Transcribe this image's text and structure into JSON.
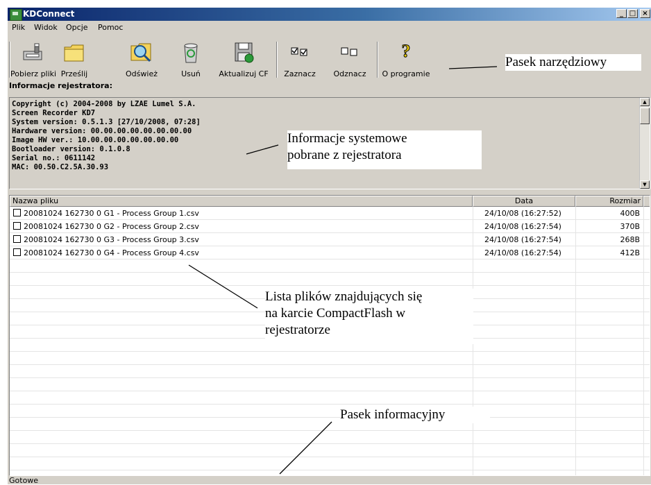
{
  "window": {
    "title": "KDConnect"
  },
  "menu": [
    "Plik",
    "Widok",
    "Opcje",
    "Pomoc"
  ],
  "toolbar": {
    "buttons": [
      {
        "label": "Pobierz pliki",
        "icon": "download-disk-icon"
      },
      {
        "label": "Prześlij",
        "icon": "folder-icon"
      },
      {
        "label": "Odśwież",
        "icon": "magnifier-icon"
      },
      {
        "label": "Usuń",
        "icon": "recycle-bin-icon"
      },
      {
        "label": "Aktualizuj CF",
        "icon": "floppy-update-icon"
      },
      {
        "label": "Zaznacz",
        "icon": "check-boxes-icon"
      },
      {
        "label": "Odznacz",
        "icon": "empty-boxes-icon"
      },
      {
        "label": "O programie",
        "icon": "help-question-icon"
      }
    ]
  },
  "info_label": "Informacje rejestratora:",
  "system_info": [
    "Copyright (c) 2004-2008 by LZAE Lumel S.A.",
    "Screen Recorder KD7",
    "System version: 0.5.1.3 [27/10/2008, 07:28]",
    "Hardware version: 00.00.00.00.00.00.00.00",
    "Image HW ver.: 10.00.00.00.00.00.00.00",
    "Bootloader version: 0.1.0.8",
    "Serial no.: 0611142",
    "MAC: 00.50.C2.5A.30.93"
  ],
  "file_list": {
    "columns": [
      "Nazwa pliku",
      "Data",
      "Rozmiar"
    ],
    "rows": [
      {
        "name": "20081024 162730 0 G1 - Process Group 1.csv",
        "date": "24/10/08 (16:27:52)",
        "size": "400B"
      },
      {
        "name": "20081024 162730 0 G2 - Process Group 2.csv",
        "date": "24/10/08 (16:27:54)",
        "size": "370B"
      },
      {
        "name": "20081024 162730 0 G3 - Process Group 3.csv",
        "date": "24/10/08 (16:27:54)",
        "size": "268B"
      },
      {
        "name": "20081024 162730 0 G4 - Process Group 4.csv",
        "date": "24/10/08 (16:27:54)",
        "size": "412B"
      }
    ]
  },
  "status": "Gotowe",
  "annotations": {
    "toolbar": "Pasek narzędziowy",
    "sysinfo_line1": "Informacje systemowe",
    "sysinfo_line2": "pobrane z rejestratora",
    "list_line1": "Lista plików znajdujących się",
    "list_line2": "na karcie CompactFlash w",
    "list_line3": "rejestratorze",
    "statusbar": "Pasek informacyjny"
  }
}
